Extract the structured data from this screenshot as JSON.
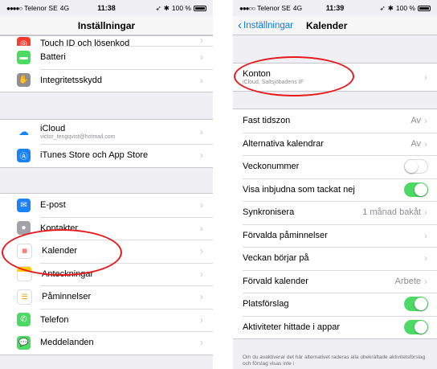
{
  "left": {
    "status": {
      "carrier": "Telenor SE",
      "network": "4G",
      "time": "11:38",
      "battery": "100 %"
    },
    "title": "Inställningar",
    "group1": [
      {
        "label": "Touch ID och lösenkod",
        "icon": "touchid-icon",
        "color": "#ff3b30"
      },
      {
        "label": "Batteri",
        "icon": "battery-icon",
        "color": "#4cd964"
      },
      {
        "label": "Integritetsskydd",
        "icon": "hand-icon",
        "color": "#8e8e93"
      }
    ],
    "group2": [
      {
        "label": "iCloud",
        "sub": "victor_tengqvist@hotmail.com",
        "icon": "icloud-icon",
        "color": "#ffffff"
      },
      {
        "label": "iTunes Store och App Store",
        "icon": "appstore-icon",
        "color": "#1a82fb"
      }
    ],
    "group3": [
      {
        "label": "E-post",
        "icon": "mail-icon",
        "color": "#1a82fb"
      },
      {
        "label": "Kontakter",
        "icon": "contacts-icon",
        "color": "#8e8e93"
      },
      {
        "label": "Kalender",
        "icon": "calendar-icon",
        "color": "#ffffff"
      },
      {
        "label": "Anteckningar",
        "icon": "notes-icon",
        "color": "#ffcc00"
      },
      {
        "label": "Påminnelser",
        "icon": "reminders-icon",
        "color": "#ffffff"
      },
      {
        "label": "Telefon",
        "icon": "phone-icon",
        "color": "#4cd964"
      },
      {
        "label": "Meddelanden",
        "icon": "messages-icon",
        "color": "#4cd964"
      }
    ]
  },
  "right": {
    "status": {
      "carrier": "Telenor SE",
      "network": "4G",
      "time": "11:39",
      "battery": "100 %"
    },
    "back_label": "Inställningar",
    "title": "Kalender",
    "konton": {
      "label": "Konton",
      "sub": "iCloud, Saltsjöbadens IF"
    },
    "rows": [
      {
        "label": "Fast tidszon",
        "value": "Av",
        "type": "chevron"
      },
      {
        "label": "Alternativa kalendrar",
        "value": "Av",
        "type": "chevron"
      },
      {
        "label": "Veckonummer",
        "type": "toggle",
        "on": false
      },
      {
        "label": "Visa inbjudna som tackat nej",
        "type": "toggle",
        "on": true
      },
      {
        "label": "Synkronisera",
        "value": "1 månad bakåt",
        "type": "chevron"
      },
      {
        "label": "Förvalda påminnelser",
        "value": "",
        "type": "chevron"
      },
      {
        "label": "Veckan börjar på",
        "value": "",
        "type": "chevron"
      },
      {
        "label": "Förvald kalender",
        "value": "Arbete",
        "type": "chevron"
      },
      {
        "label": "Platsförslag",
        "type": "toggle",
        "on": true
      },
      {
        "label": "Aktiviteter hittade i appar",
        "type": "toggle",
        "on": true
      }
    ],
    "footer": "Om du avaktiverar det här alternativet raderas alla obekräftade aktivitetsförslag och förslag visas inte i"
  },
  "colors": {
    "accent": "#007aff",
    "toggle_on": "#4cd964",
    "annotation": "#e8191c"
  }
}
